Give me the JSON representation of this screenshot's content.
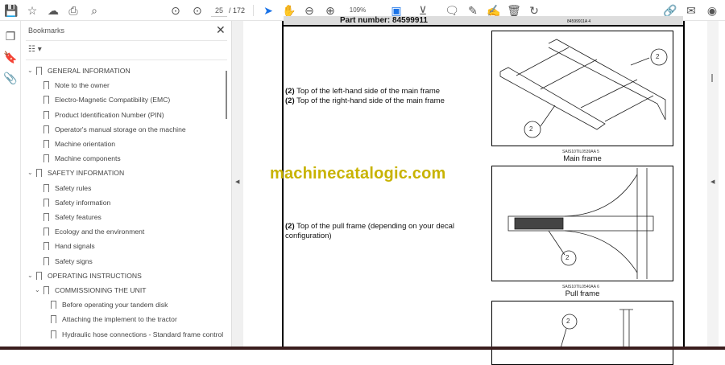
{
  "toolbar": {
    "current_page": "25",
    "total_pages": "/ 172",
    "zoom": "109%"
  },
  "bookmarks": {
    "title": "Bookmarks",
    "items": [
      {
        "label": "GENERAL INFORMATION",
        "level": 0,
        "expanded": true
      },
      {
        "label": "Note to the owner",
        "level": 1
      },
      {
        "label": "Electro-Magnetic Compatibility (EMC)",
        "level": 1
      },
      {
        "label": "Product Identification Number (PIN)",
        "level": 1
      },
      {
        "label": "Operator's manual storage on the machine",
        "level": 1
      },
      {
        "label": "Machine orientation",
        "level": 1
      },
      {
        "label": "Machine components",
        "level": 1
      },
      {
        "label": "SAFETY INFORMATION",
        "level": 0,
        "expanded": true
      },
      {
        "label": "Safety rules",
        "level": 1
      },
      {
        "label": "Safety information",
        "level": 1
      },
      {
        "label": "Safety features",
        "level": 1
      },
      {
        "label": "Ecology and the environment",
        "level": 1
      },
      {
        "label": "Hand signals",
        "level": 1
      },
      {
        "label": "Safety signs",
        "level": 1
      },
      {
        "label": "OPERATING INSTRUCTIONS",
        "level": 0,
        "expanded": true
      },
      {
        "label": "COMMISSIONING THE UNIT",
        "level": 1,
        "expanded": true
      },
      {
        "label": "Before operating your tandem disk",
        "level": 2
      },
      {
        "label": "Attaching the implement to the tractor",
        "level": 2
      },
      {
        "label": "Hydraulic hose connections - Standard frame control",
        "level": 2
      }
    ]
  },
  "document": {
    "part_number": "Part number: 84599911",
    "page_code": "84599911A   4",
    "main_frame_lines": [
      {
        "num": "(2)",
        "text": " Top of the left-hand side of the main frame"
      },
      {
        "num": "(2)",
        "text": " Top of the right-hand side of the main frame"
      }
    ],
    "pull_frame_line": {
      "num": "(2)",
      "text": " Top of the pull frame (depending on your decal configuration)"
    },
    "fig1": {
      "code": "SAIS10TIL0539AA   5",
      "title": "Main frame",
      "callout": "2"
    },
    "fig2": {
      "code": "SAIS10TIL0540AA   6",
      "title": "Pull frame",
      "callout": "2"
    },
    "fig3": {
      "callout": "2"
    }
  },
  "watermark": "machinecatalogic.com",
  "colors": {
    "accent": "#1a73e8",
    "watermark": "#c8b300"
  }
}
